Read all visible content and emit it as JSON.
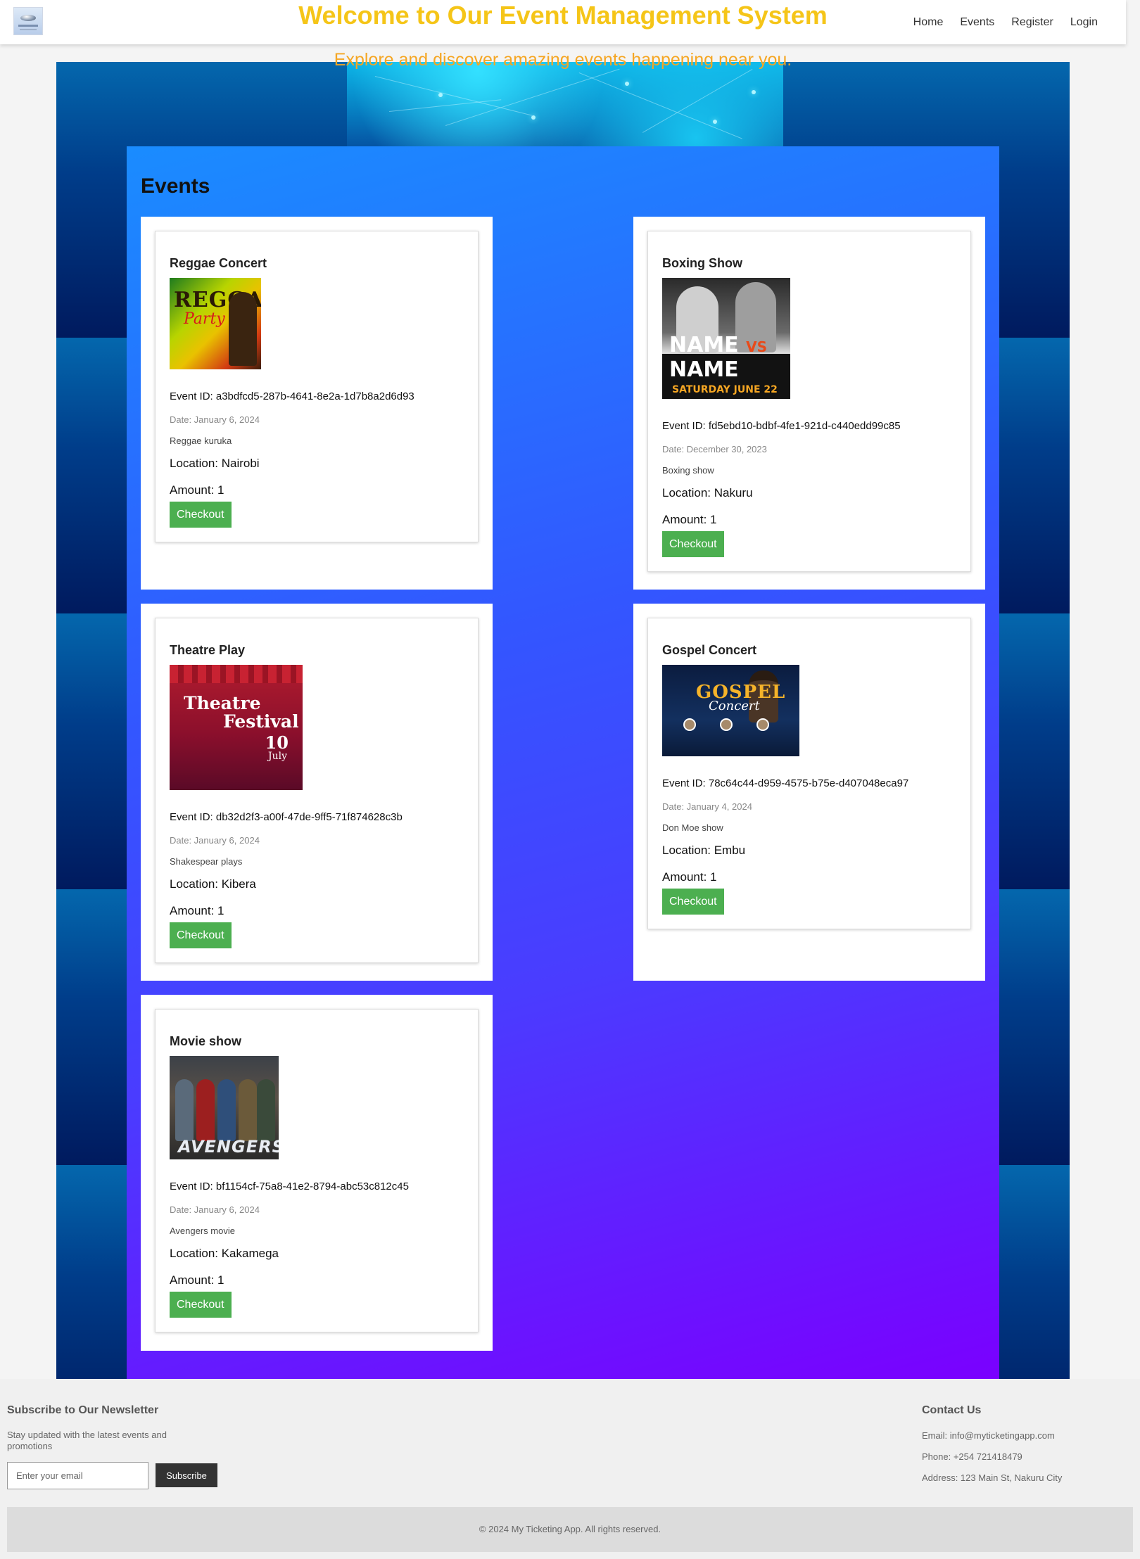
{
  "nav": {
    "links": [
      "Home",
      "Events",
      "Register",
      "Login"
    ]
  },
  "hero": {
    "title": "Welcome to Our Event Management System",
    "subtitle": "Explore and discover amazing events happening near you."
  },
  "events": {
    "heading": "Events",
    "checkout_label": "Checkout",
    "items": [
      {
        "title": "Reggae Concert",
        "poster": {
          "main": "REGGAE",
          "script": "Party"
        },
        "id_text": "Event ID: a3bdfcd5-287b-4641-8e2a-1d7b8a2d6d93",
        "date": "Date: January 6, 2024",
        "description": "Reggae kuruka",
        "location": "Location: Nairobi",
        "amount": "Amount: 1"
      },
      {
        "title": "Boxing Show",
        "poster": {
          "names": "NAME",
          "vs": "VS",
          "day": "SATURDAY",
          "date": "JUNE 22"
        },
        "id_text": "Event ID: fd5ebd10-bdbf-4fe1-921d-c440edd99c85",
        "date": "Date: December 30, 2023",
        "description": "Boxing show",
        "location": "Location: Nakuru",
        "amount": "Amount: 1"
      },
      {
        "title": "Theatre Play",
        "poster": {
          "line1": "Theatre",
          "line2": "Festival",
          "day": "10",
          "month": "July"
        },
        "id_text": "Event ID: db32d2f3-a00f-47de-9ff5-71f874628c3b",
        "date": "Date: January 6, 2024",
        "description": "Shakespear plays",
        "location": "Location: Kibera",
        "amount": "Amount: 1"
      },
      {
        "title": "Gospel Concert",
        "poster": {
          "main": "GOSPEL",
          "script": "Concert"
        },
        "id_text": "Event ID: 78c64c44-d959-4575-b75e-d407048eca97",
        "date": "Date: January 4, 2024",
        "description": "Don Moe show",
        "location": "Location: Embu",
        "amount": "Amount: 1"
      },
      {
        "title": "Movie show",
        "poster": {
          "main": "AVENGERS"
        },
        "id_text": "Event ID: bf1154cf-75a8-41e2-8794-abc53c812c45",
        "date": "Date: January 6, 2024",
        "description": "Avengers movie",
        "location": "Location: Kakamega",
        "amount": "Amount: 1"
      }
    ]
  },
  "footer": {
    "newsletter_title": "Subscribe to Our Newsletter",
    "newsletter_text": "Stay updated with the latest events and promotions",
    "email_placeholder": "Enter your email",
    "subscribe_label": "Subscribe",
    "contact_title": "Contact Us",
    "email": "Email: info@myticketingapp.com",
    "phone": "Phone: +254 721418479",
    "address": "Address: 123 Main St, Nakuru City",
    "copyright": "© 2024 My Ticketing App. All rights reserved."
  },
  "colors": {
    "hero_title": "#f5c518",
    "hero_subtitle": "#f5a623",
    "checkout_button": "#4caf50",
    "subscribe_button": "#333333"
  }
}
